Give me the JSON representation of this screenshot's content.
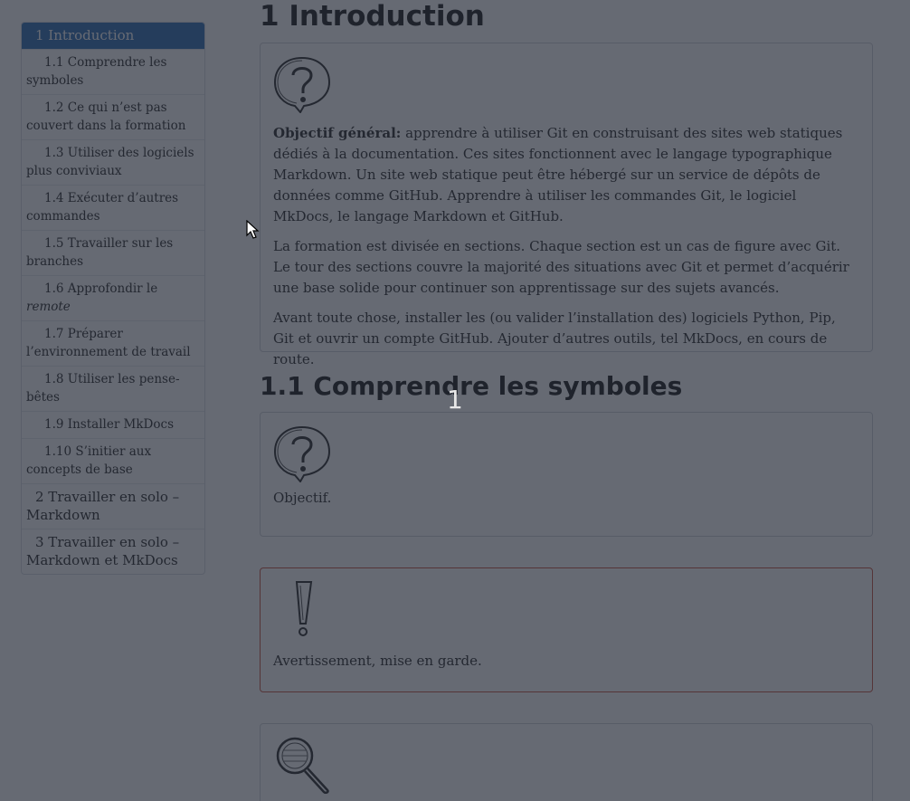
{
  "toc": {
    "items": [
      {
        "label": "1 Introduction"
      },
      {
        "label": "1.1 Comprendre les symboles"
      },
      {
        "label": "1.2 Ce qui n’est pas couvert dans la formation"
      },
      {
        "label": "1.3 Utiliser des logiciels plus conviviaux"
      },
      {
        "label": "1.4 Exécuter d’autres commandes"
      },
      {
        "label": "1.5 Travailler sur les branches"
      },
      {
        "label_prefix": "1.6 Approfondir le ",
        "label_em": "remote"
      },
      {
        "label": "1.7 Préparer l’environnement de travail"
      },
      {
        "label": "1.8 Utiliser les pense-bêtes"
      },
      {
        "label": "1.9 Installer MkDocs"
      },
      {
        "label": "1.10 S’initier aux concepts de base"
      },
      {
        "label": "2 Travailler en solo – Markdown"
      },
      {
        "label": "3 Travailler en solo – Markdown et MkDocs"
      }
    ]
  },
  "main": {
    "title": "1 Introduction",
    "intro_box": {
      "objective_label": "Objectif général:",
      "objective_text": " apprendre à utiliser Git en construisant des sites web statiques dédiés à la documentation. Ces sites fonctionnent avec le langage typographique Markdown. Un site web statique peut être hébergé sur un service de dépôts de données comme GitHub. Apprendre à utiliser les commandes Git, le logiciel MkDocs, le langage Markdown et GitHub.",
      "para2": "La formation est divisée en sections. Chaque section est un cas de figure avec Git. Le tour des sections couvre la majorité des situations avec Git et permet d’acquérir une base solide pour continuer son apprentissage sur des sujets avancés.",
      "para3": "Avant toute chose, installer les (ou valider l’installation des) logiciels Python, Pip, Git et ouvrir un compte GitHub. Ajouter d’autres outils, tel MkDocs, en cours de route."
    },
    "section_title": "1.1 Comprendre les symboles",
    "symbol_objective": "Objectif.",
    "symbol_warning": "Avertissement, mise en garde."
  },
  "overlay": {
    "number": "1"
  },
  "colors": {
    "active_toc": "#3774b8",
    "warning_border": "#c95a4a"
  }
}
